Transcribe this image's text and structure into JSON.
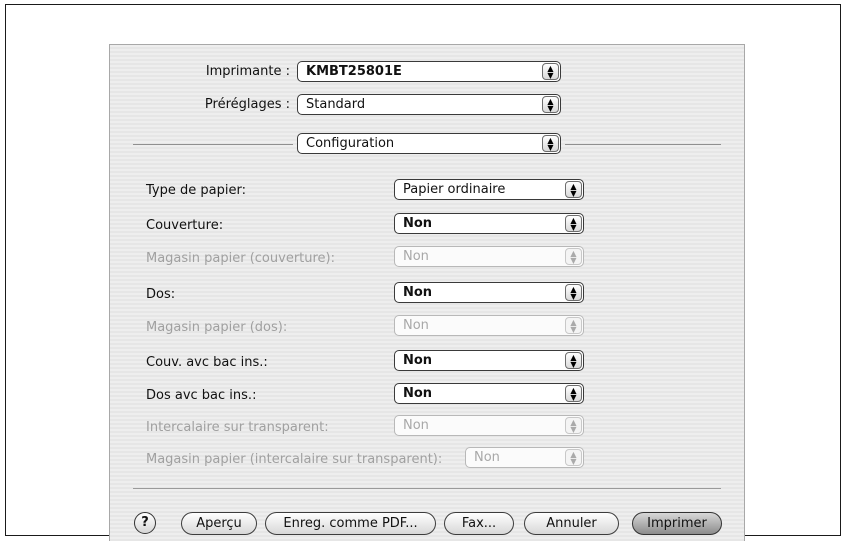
{
  "printer": {
    "label": "Imprimante :",
    "value": "KMBT25801E"
  },
  "presets": {
    "label": "Préréglages :",
    "value": "Standard"
  },
  "section": {
    "value": "Configuration"
  },
  "options": [
    {
      "label": "Type de papier:",
      "value": "Papier ordinaire",
      "enabled": true
    },
    {
      "label": "Couverture:",
      "value": "Non",
      "enabled": true
    },
    {
      "label": "Magasin papier (couverture):",
      "value": "Non",
      "enabled": false
    },
    {
      "label": "Dos:",
      "value": "Non",
      "enabled": true
    },
    {
      "label": "Magasin papier (dos):",
      "value": "Non",
      "enabled": false
    },
    {
      "label": "Couv. avc bac ins.:",
      "value": "Non",
      "enabled": true
    },
    {
      "label": "Dos avc bac ins.:",
      "value": "Non",
      "enabled": true
    },
    {
      "label": "Intercalaire sur transparent:",
      "value": "Non",
      "enabled": false
    },
    {
      "label": "Magasin papier (intercalaire sur transparent):",
      "value": "Non",
      "enabled": false
    }
  ],
  "buttons": {
    "help": "?",
    "preview": "Aperçu",
    "save_pdf": "Enreg. comme PDF...",
    "fax": "Fax...",
    "cancel": "Annuler",
    "print": "Imprimer"
  },
  "icons": {
    "popup_arrow": "up-down-arrows-icon",
    "help": "question-mark-icon"
  }
}
